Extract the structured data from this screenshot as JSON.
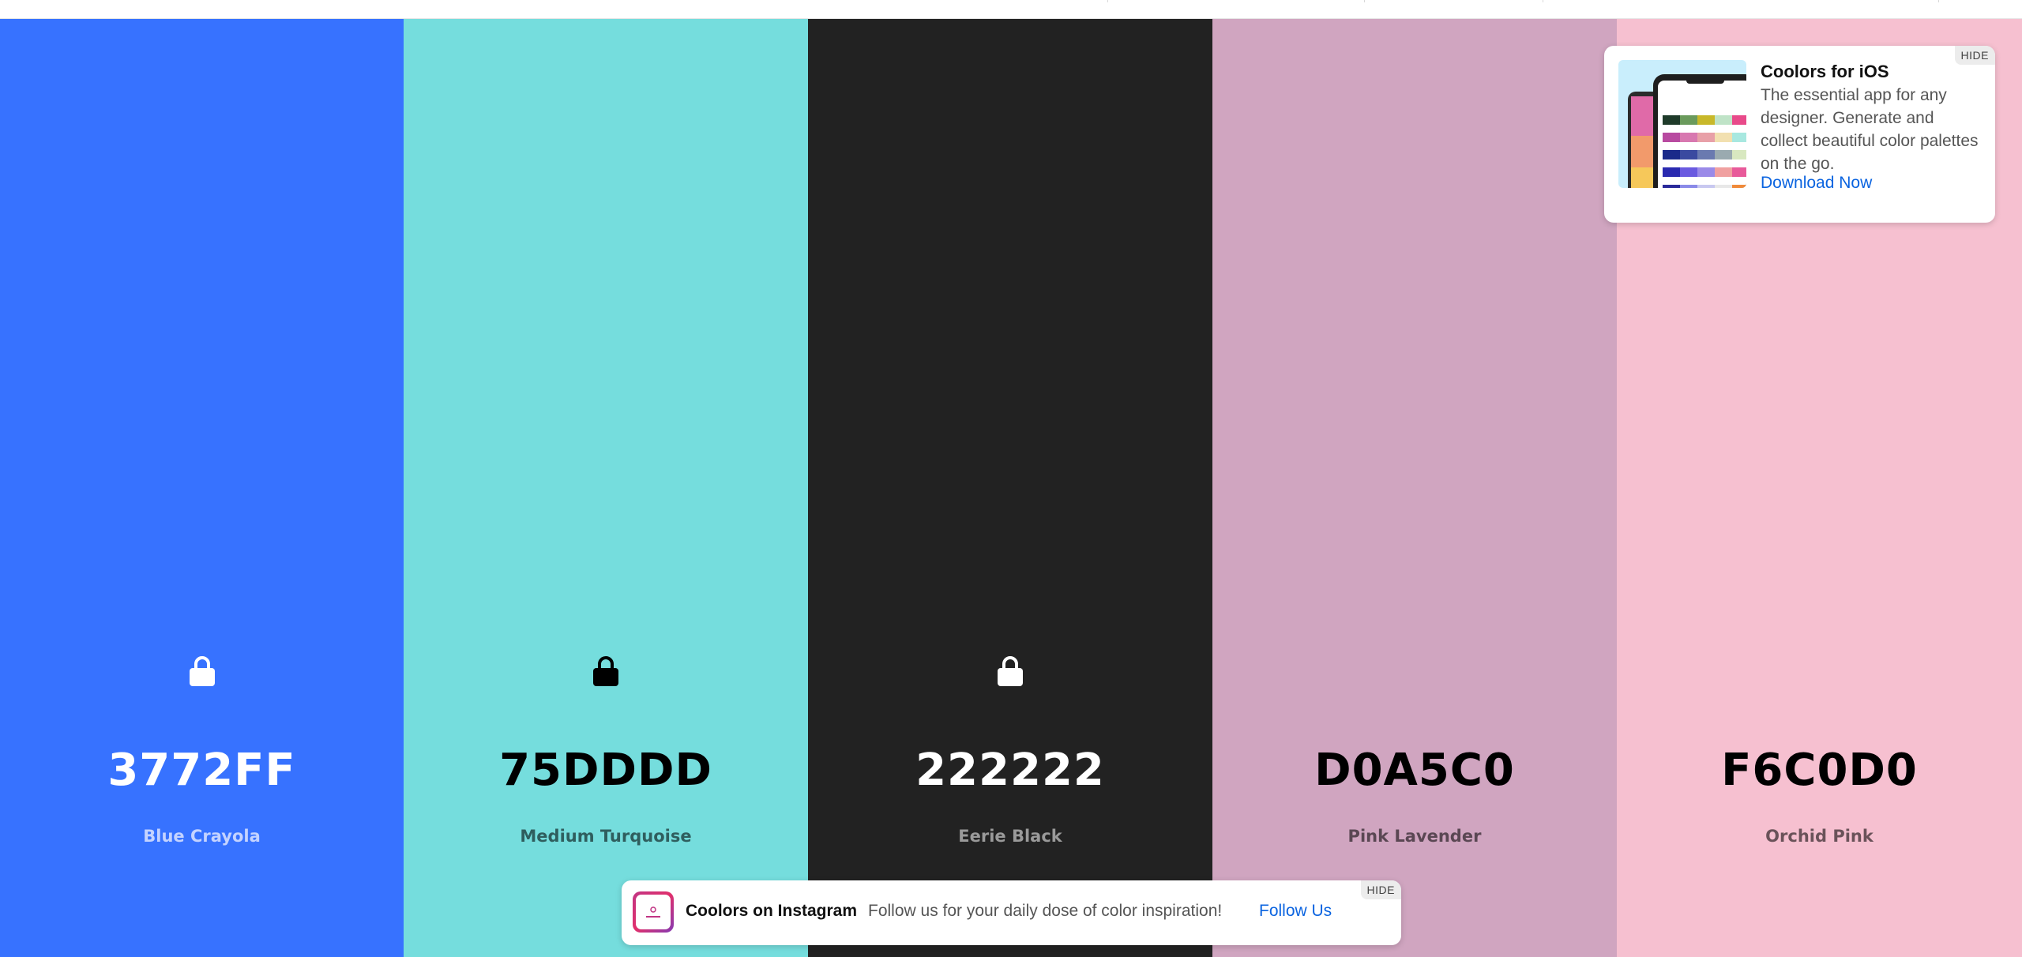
{
  "palette": {
    "colors": [
      {
        "hex": "3772FF",
        "name": "Blue Crayola",
        "bg": "#3772FF",
        "text_color": "#ffffff",
        "name_color": "#c4d3ff",
        "lock_color": "#ffffff"
      },
      {
        "hex": "75DDDD",
        "name": "Medium Turquoise",
        "bg": "#75DDDD",
        "text_color": "#000000",
        "name_color": "#2f5e5e",
        "lock_color": "#000000"
      },
      {
        "hex": "222222",
        "name": "Eerie Black",
        "bg": "#222222",
        "text_color": "#ffffff",
        "name_color": "#9a9a9a",
        "lock_color": "#ffffff"
      },
      {
        "hex": "D0A5C0",
        "name": "Pink Lavender",
        "bg": "#D0A5C0",
        "text_color": "#000000",
        "name_color": "#5a4753",
        "lock_color": "#000000"
      },
      {
        "hex": "F6C0D0",
        "name": "Orchid Pink",
        "bg": "#F6C0D0",
        "text_color": "#000000",
        "name_color": "#6a5259",
        "lock_color": "#000000"
      }
    ]
  },
  "ios_promo": {
    "title": "Coolors for iOS",
    "description": "The essential app for any designer. Generate and collect beautiful color palettes on the go.",
    "link": "Download Now",
    "hide": "HIDE"
  },
  "instagram_banner": {
    "title": "Coolors on Instagram",
    "text": "Follow us for your daily dose of color inspiration!",
    "link": "Follow Us",
    "hide": "HIDE"
  }
}
